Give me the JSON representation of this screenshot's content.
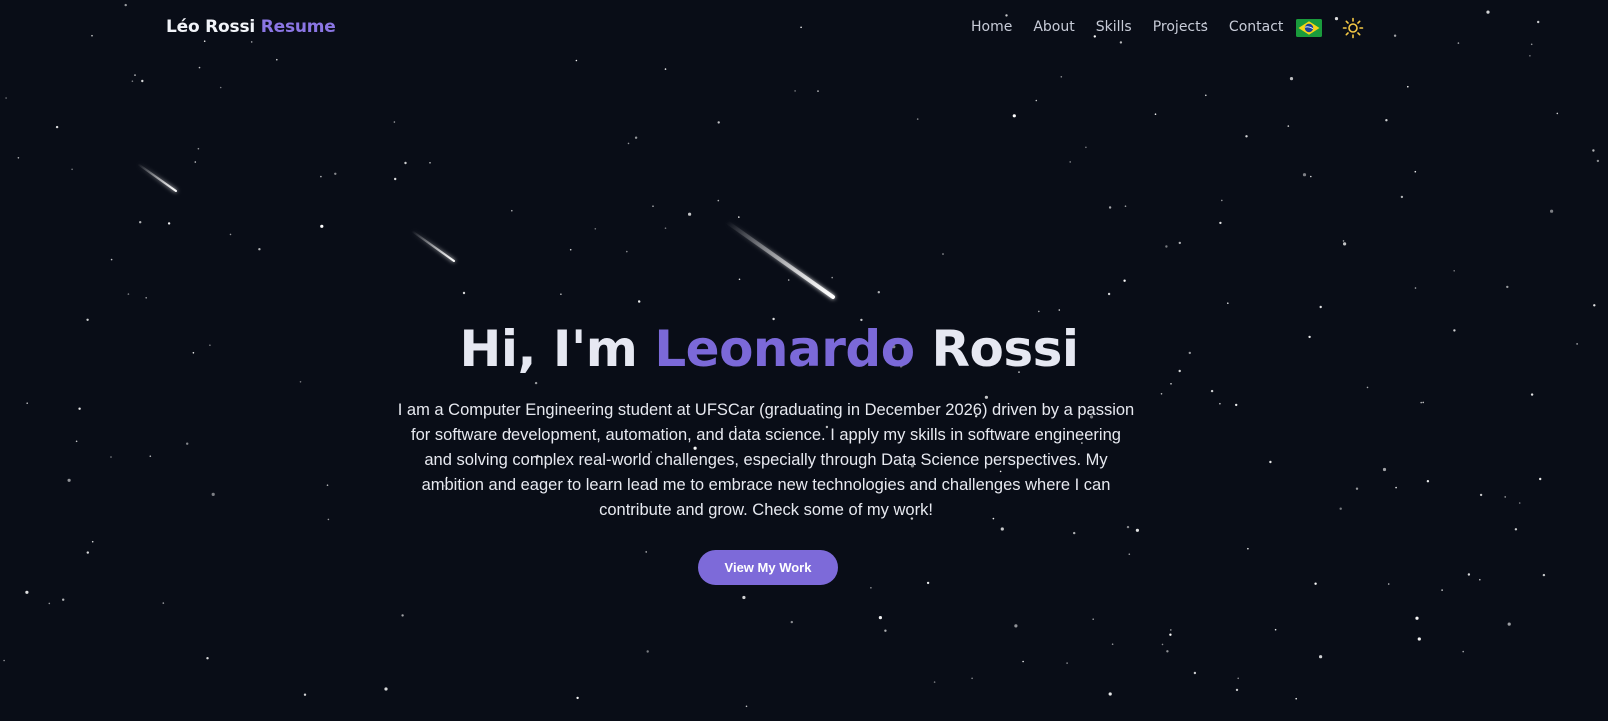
{
  "nav": {
    "brand_name": "Léo Rossi",
    "brand_suffix": "Resume",
    "links": [
      "Home",
      "About",
      "Skills",
      "Projects",
      "Contact"
    ],
    "language_icon": "brazil-flag-icon",
    "theme_icon": "sun-icon"
  },
  "hero": {
    "greeting": "Hi, I'm",
    "first_name": "Leonardo",
    "last_name": "Rossi",
    "description": "I am a Computer Engineering student at UFSCar (graduating in December 2026) driven by a passion for software development, automation, and data science. I apply my skills in software engineering and solving complex real-world challenges, especially through Data Science perspectives. My ambition and eager to learn lead me to embrace new technologies and challenges where I can contribute and grow. Check some of my work!",
    "cta_label": "View My Work"
  },
  "colors": {
    "background": "#090d17",
    "accent": "#7b69d8",
    "button": "#7d6ad9",
    "sun": "#f6c945"
  }
}
